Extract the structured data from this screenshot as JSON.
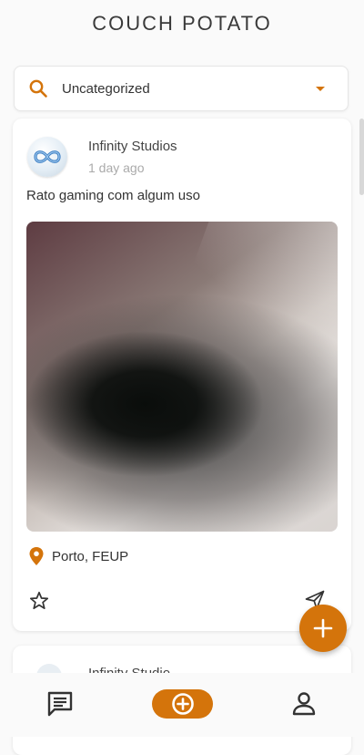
{
  "app": {
    "title": "COUCH POTATO"
  },
  "search": {
    "category_value": "Uncategorized"
  },
  "posts": [
    {
      "author": "Infinity Studios",
      "time": "1 day ago",
      "text": "Rato gaming com algum uso",
      "location": "Porto, FEUP"
    },
    {
      "author": "Infinity Studio"
    }
  ],
  "colors": {
    "accent": "#d4740b",
    "background": "#fafafa",
    "card": "#ffffff",
    "text_primary": "#333333",
    "text_secondary": "#aaaaaa"
  },
  "icons": {
    "search": "search-icon",
    "dropdown": "caret-down-icon",
    "location": "location-pin-icon",
    "favorite": "star-outline-icon",
    "share": "send-icon",
    "fab": "plus-icon",
    "nav_chat": "chat-icon",
    "nav_add": "add-circle-icon",
    "nav_profile": "person-icon"
  }
}
